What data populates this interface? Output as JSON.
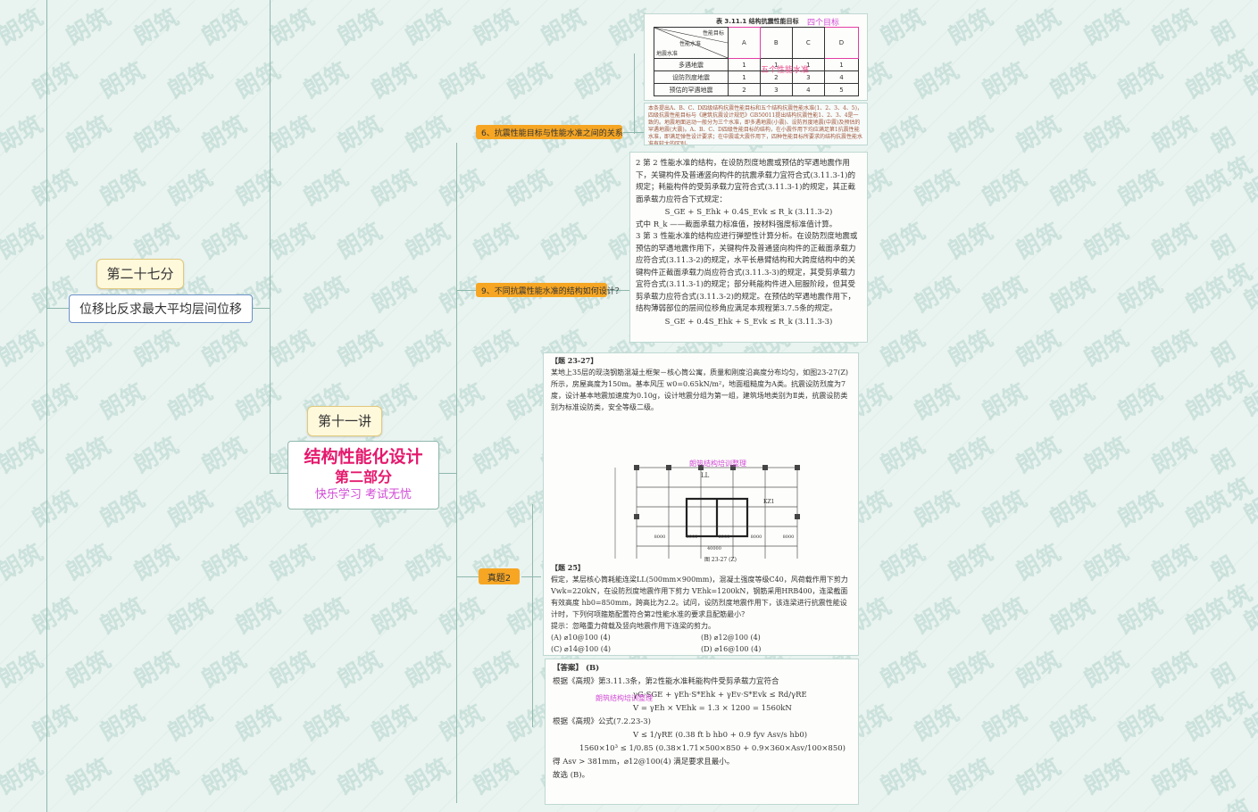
{
  "watermark": "朗筑",
  "nodes": {
    "section27": "第二十七分",
    "drift_ratio": "位移比反求最大平均层间位移",
    "lecture11": "第十一讲",
    "main_title": "结构性能化设计",
    "main_sub": "第二部分",
    "main_slogan": "快乐学习  考试无忧",
    "branch6": "6、抗震性能目标与性能水准之间的关系",
    "branch9": "9、不同抗震性能水准的结构如何设计？",
    "branch_real": "真题2"
  },
  "table_card": {
    "caption": "表 3.11.1    结构抗震性能目标",
    "annot_targets": "四个目标",
    "annot_levels": "五个性能水准",
    "header_diag_top": "性能目标",
    "header_diag_mid": "性能水准",
    "header_diag_bot": "地震水准",
    "cols": [
      "A",
      "B",
      "C",
      "D"
    ],
    "rows": [
      {
        "label": "多遇地震",
        "vals": [
          "1",
          "1",
          "1",
          "1"
        ]
      },
      {
        "label": "设防烈度地震",
        "vals": [
          "1",
          "2",
          "3",
          "4"
        ]
      },
      {
        "label": "预估的罕遇地震",
        "vals": [
          "2",
          "3",
          "4",
          "5"
        ]
      }
    ]
  },
  "note_card": {
    "text": "本条提出A、B、C、D四级结构抗震性能目标和五个结构抗震性能水准(1、2、3、4、5)，四级抗震性能目标与《建筑抗震设计规范》GB50011提出结构抗震性能1、2、3、4是一致的。地震地面运动一般分为三个水准，即多遇地震(小震)、设防烈度地震(中震)及预估的罕遇地震(大震)。A、B、C、D四级性能目标的结构，在小震作用下均应满足第1抗震性能水准，即满足弹性设计要求；在中震或大震作用下，四种性能目标所要求的结构抗震性能水准有较大的区别。"
  },
  "spec_card": {
    "p1": "2  第 2 性能水准的结构，在设防烈度地震或预估的罕遇地震作用下，关键构件及普通竖向构件的抗震承载力宜符合式(3.11.3-1)的规定；耗能构件的受剪承载力宜符合式(3.11.3-1)的规定，其正截面承载力应符合下式规定：",
    "eq2": "S_GE + S_Ehk + 0.4S_Evk ≤ R_k        (3.11.3-2)",
    "p1b": "式中 R_k ——截面承载力标准值，按材料强度标准值计算。",
    "p2": "3  第 3 性能水准的结构应进行弹塑性计算分析。在设防烈度地震或预估的罕遇地震作用下，关键构件及普通竖向构件的正截面承载力应符合式(3.11.3-2)的规定，水平长悬臂结构和大跨度结构中的关键构件正截面承载力尚应符合式(3.11.3-3)的规定，其受剪承载力宜符合式(3.11.3-1)的规定；部分耗能构件进入屈服阶段，但其受剪承载力应符合式(3.11.3-2)的规定。在预估的罕遇地震作用下，结构薄弱部位的层间位移角应满足本规程第3.7.5条的规定。",
    "eq3": "S_GE + 0.4S_Ehk + S_Evk ≤ R_k        (3.11.3-3)"
  },
  "problem_card": {
    "title": "【题 23-27】",
    "text": "某地上35层的现浇钢筋混凝土框架－核心筒公寓，质量和刚度沿高度分布均匀，如图23-27(Z)所示，房屋高度为150m。基本风压 w0=0.65kN/m²，地面粗糙度为A类。抗震设防烈度为7度，设计基本地震加速度为0.10g，设计地震分组为第一组，建筑场地类别为Ⅱ类，抗震设防类别为标准设防类，安全等级二级。",
    "fig_caption": "图 23-27 (Z)",
    "fig_watermark": "朗筑结构培训整理",
    "fig_dims": [
      "8000",
      "8000",
      "8000",
      "8000",
      "8000"
    ],
    "fig_total": "40000",
    "fig_ll": "LL",
    "fig_kz": "KZ1",
    "q_title": "【题 25】",
    "q_text": "假定，某层核心筒耗能连梁LL(500mm×900mm)，混凝土强度等级C40，风荷载作用下剪力 Vwk=220kN，在设防烈度地震作用下剪力 VEhk=1200kN，钢筋采用HRB400，连梁截面有效高度 hb0=850mm，跨高比为2.2。试问，设防烈度地震作用下，该连梁进行抗震性能设计时，下列何项箍筋配置符合第2性能水准的要求且配筋最小？",
    "q_hint": "提示：忽略重力荷载及竖向地震作用下连梁的剪力。",
    "options": [
      "(A) ⌀10@100 (4)",
      "(B) ⌀12@100 (4)",
      "(C) ⌀14@100 (4)",
      "(D) ⌀16@100 (4)"
    ]
  },
  "answer_card": {
    "title": "【答案】 (B)",
    "l1": "根据《高规》第3.11.3条，第2性能水准耗能构件受剪承载力宜符合",
    "l2": "γG·SGE + γEh·S*Ehk + γEv·S*Evk ≤ Rd/γRE",
    "l3": "V = γEh × VEhk = 1.3 × 1200 = 1560kN",
    "l4": "根据《高规》公式(7.2.23-3)",
    "l5": "V ≤ 1/γRE (0.38 ft b hb0 + 0.9 fyv Asv/s hb0)",
    "l6": "1560×10³ ≤ 1/0.85 (0.38×1.71×500×850 + 0.9×360×Asv/100×850)",
    "l7": "得 Asv > 381mm，⌀12@100(4) 满足要求且最小。",
    "l8": "故选 (B)。",
    "wm": "朗筑结构培训整理"
  }
}
